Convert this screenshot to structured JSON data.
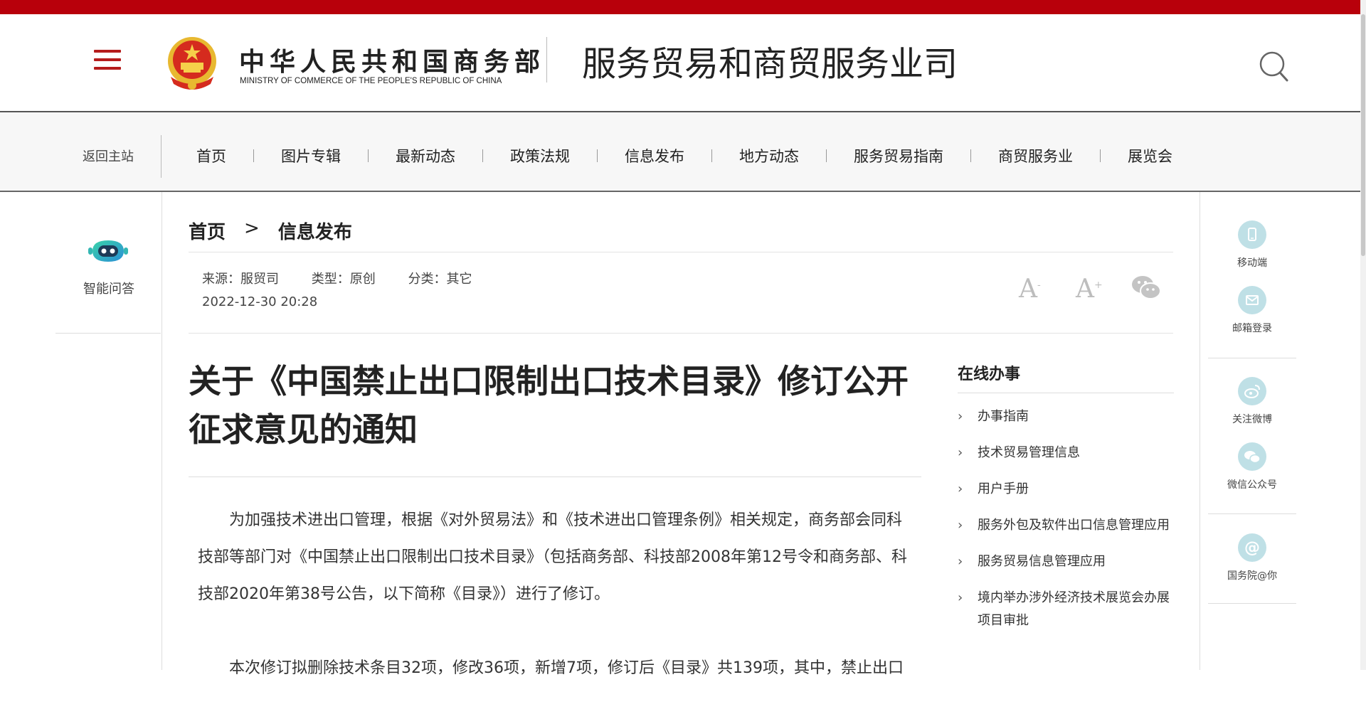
{
  "header": {
    "ministry_cn": "中华人民共和国商务部",
    "ministry_en": "MINISTRY OF COMMERCE OF THE PEOPLE'S REPUBLIC OF CHINA",
    "dept_title": "服务贸易和商贸服务业司"
  },
  "nav": {
    "back_home": "返回主站",
    "items": [
      "首页",
      "图片专辑",
      "最新动态",
      "政策法规",
      "信息发布",
      "地方动态",
      "服务贸易指南",
      "商贸服务业",
      "展览会"
    ]
  },
  "left_sidebar": {
    "robot_label": "智能问答"
  },
  "breadcrumb": {
    "home": "首页",
    "separator": ">",
    "current": "信息发布"
  },
  "meta": {
    "source": "来源：服贸司",
    "type": "类型：原创",
    "category": "分类：其它",
    "date": "2022-12-30 20:28"
  },
  "tools": {
    "font_small": "A",
    "font_small_mark": "-",
    "font_large": "A",
    "font_large_mark": "+"
  },
  "article": {
    "title": "关于《中国禁止出口限制出口技术目录》修订公开征求意见的通知",
    "paragraphs": [
      "为加强技术进出口管理，根据《对外贸易法》和《技术进出口管理条例》相关规定，商务部会同科技部等部门对《中国禁止出口限制出口技术目录》（包括商务部、科技部2008年第12号令和商务部、科技部2020年第38号公告，以下简称《目录》）进行了修订。",
      "本次修订拟删除技术条目32项，修改36项，新增7项，修订后《目录》共139项，其中，禁止出口"
    ]
  },
  "services": {
    "title": "在线办事",
    "items": [
      "办事指南",
      "技术贸易管理信息",
      "用户手册",
      "服务外包及软件出口信息管理应用",
      "服务贸易信息管理应用",
      "境内举办涉外经济技术展览会办展项目审批"
    ]
  },
  "right_sidebar": {
    "mobile": "移动端",
    "email": "邮箱登录",
    "weibo": "关注微博",
    "wechat": "微信公众号",
    "state_council": "国务院@你"
  },
  "colors": {
    "brand_red": "#b8000b",
    "icon_teal": "#bfe0e6",
    "robot_green": "#2cc7a0"
  }
}
